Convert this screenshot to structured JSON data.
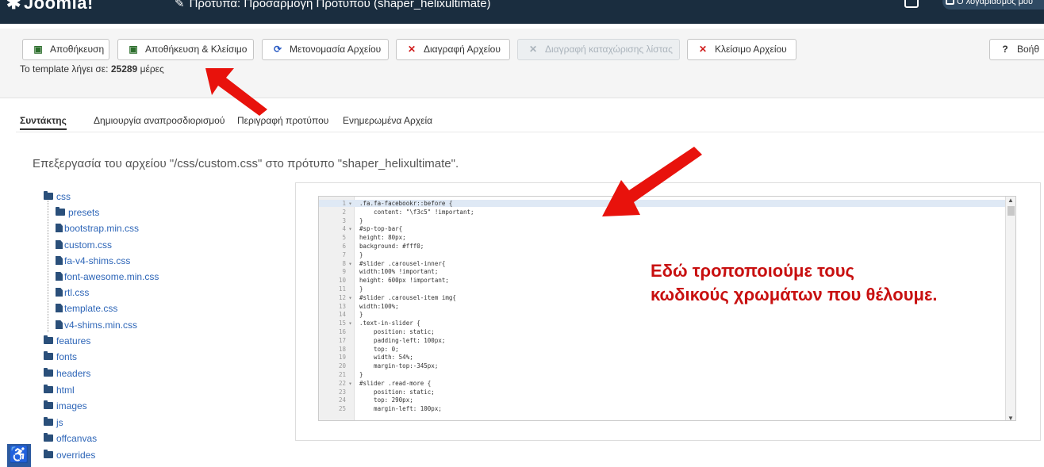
{
  "header": {
    "brand": "Joomla!",
    "page_title": "Πρότυπα: Προσαρμογή Προτύπου (shaper_helixultimate)",
    "user_label": "Ο λογαριασμός μου"
  },
  "toolbar": {
    "save": "Αποθήκευση",
    "save_close": "Αποθήκευση & Κλείσιμο",
    "rename": "Μετονομασία Αρχείου",
    "delete": "Διαγραφή Αρχείου",
    "delete_list": "Διαγραφή καταχώρισης λίστας",
    "close": "Κλείσιμο Αρχείου",
    "help": "Βοήθ"
  },
  "expiry": {
    "prefix": "Το template λήγει σε:",
    "days": "25289",
    "suffix": "μέρες"
  },
  "tabs": [
    "Συντάκτης",
    "Δημιουργία αναπροσδιορισμού",
    "Περιγραφή προτύπου",
    "Ενημερωμένα Αρχεία"
  ],
  "editing_title": "Επεξεργασία του αρχείου \"/css/custom.css\" στο πρότυπο \"shaper_helixultimate\".",
  "tree": {
    "folders_top": "css",
    "css_children": [
      {
        "type": "folder",
        "name": "presets"
      },
      {
        "type": "file",
        "name": "bootstrap.min.css"
      },
      {
        "type": "file",
        "name": "custom.css"
      },
      {
        "type": "file",
        "name": "fa-v4-shims.css"
      },
      {
        "type": "file",
        "name": "font-awesome.min.css"
      },
      {
        "type": "file",
        "name": "rtl.css"
      },
      {
        "type": "file",
        "name": "template.css"
      },
      {
        "type": "file",
        "name": "v4-shims.min.css"
      }
    ],
    "other_folders": [
      "features",
      "fonts",
      "headers",
      "html",
      "images",
      "js",
      "offcanvas",
      "overrides"
    ]
  },
  "code": [
    {
      "n": "1",
      "f": "▾",
      "t": ".fa.fa-facebookr::before {"
    },
    {
      "n": "2",
      "f": "",
      "t": "    content: \"\\f3c5\" !important;"
    },
    {
      "n": "3",
      "f": "",
      "t": "}"
    },
    {
      "n": "4",
      "f": "▾",
      "t": "#sp-top-bar{"
    },
    {
      "n": "5",
      "f": "",
      "t": "height: 80px;"
    },
    {
      "n": "6",
      "f": "",
      "t": "background: #fff0;"
    },
    {
      "n": "7",
      "f": "",
      "t": "}"
    },
    {
      "n": "8",
      "f": "▾",
      "t": "#slider .carousel-inner{"
    },
    {
      "n": "9",
      "f": "",
      "t": "width:100% !important;"
    },
    {
      "n": "10",
      "f": "",
      "t": "height: 600px !important;"
    },
    {
      "n": "11",
      "f": "",
      "t": "}"
    },
    {
      "n": "12",
      "f": "▾",
      "t": "#slider .carousel-item img{"
    },
    {
      "n": "13",
      "f": "",
      "t": "width:100%;"
    },
    {
      "n": "14",
      "f": "",
      "t": "}"
    },
    {
      "n": "15",
      "f": "▾",
      "t": ".text-in-slider {"
    },
    {
      "n": "16",
      "f": "",
      "t": "    position: static;"
    },
    {
      "n": "17",
      "f": "",
      "t": "    padding-left: 100px;"
    },
    {
      "n": "18",
      "f": "",
      "t": "    top: 0;"
    },
    {
      "n": "19",
      "f": "",
      "t": "    width: 54%;"
    },
    {
      "n": "20",
      "f": "",
      "t": "    margin-top:-345px;"
    },
    {
      "n": "21",
      "f": "",
      "t": "}"
    },
    {
      "n": "22",
      "f": "▾",
      "t": "#slider .read-more {"
    },
    {
      "n": "23",
      "f": "",
      "t": "    position: static;"
    },
    {
      "n": "24",
      "f": "",
      "t": "    top: 290px;"
    },
    {
      "n": "25",
      "f": "",
      "t": "    margin-left: 100px;"
    }
  ],
  "annotation": {
    "line1": "Εδώ τροποποιούμε τους",
    "line2": "κωδικούς χρωμάτων που θέλουμε."
  },
  "colors": {
    "header_bg": "#1a2d3f",
    "arrow": "#e8120c",
    "annotation": "#c81010",
    "link": "#2e66b8"
  }
}
